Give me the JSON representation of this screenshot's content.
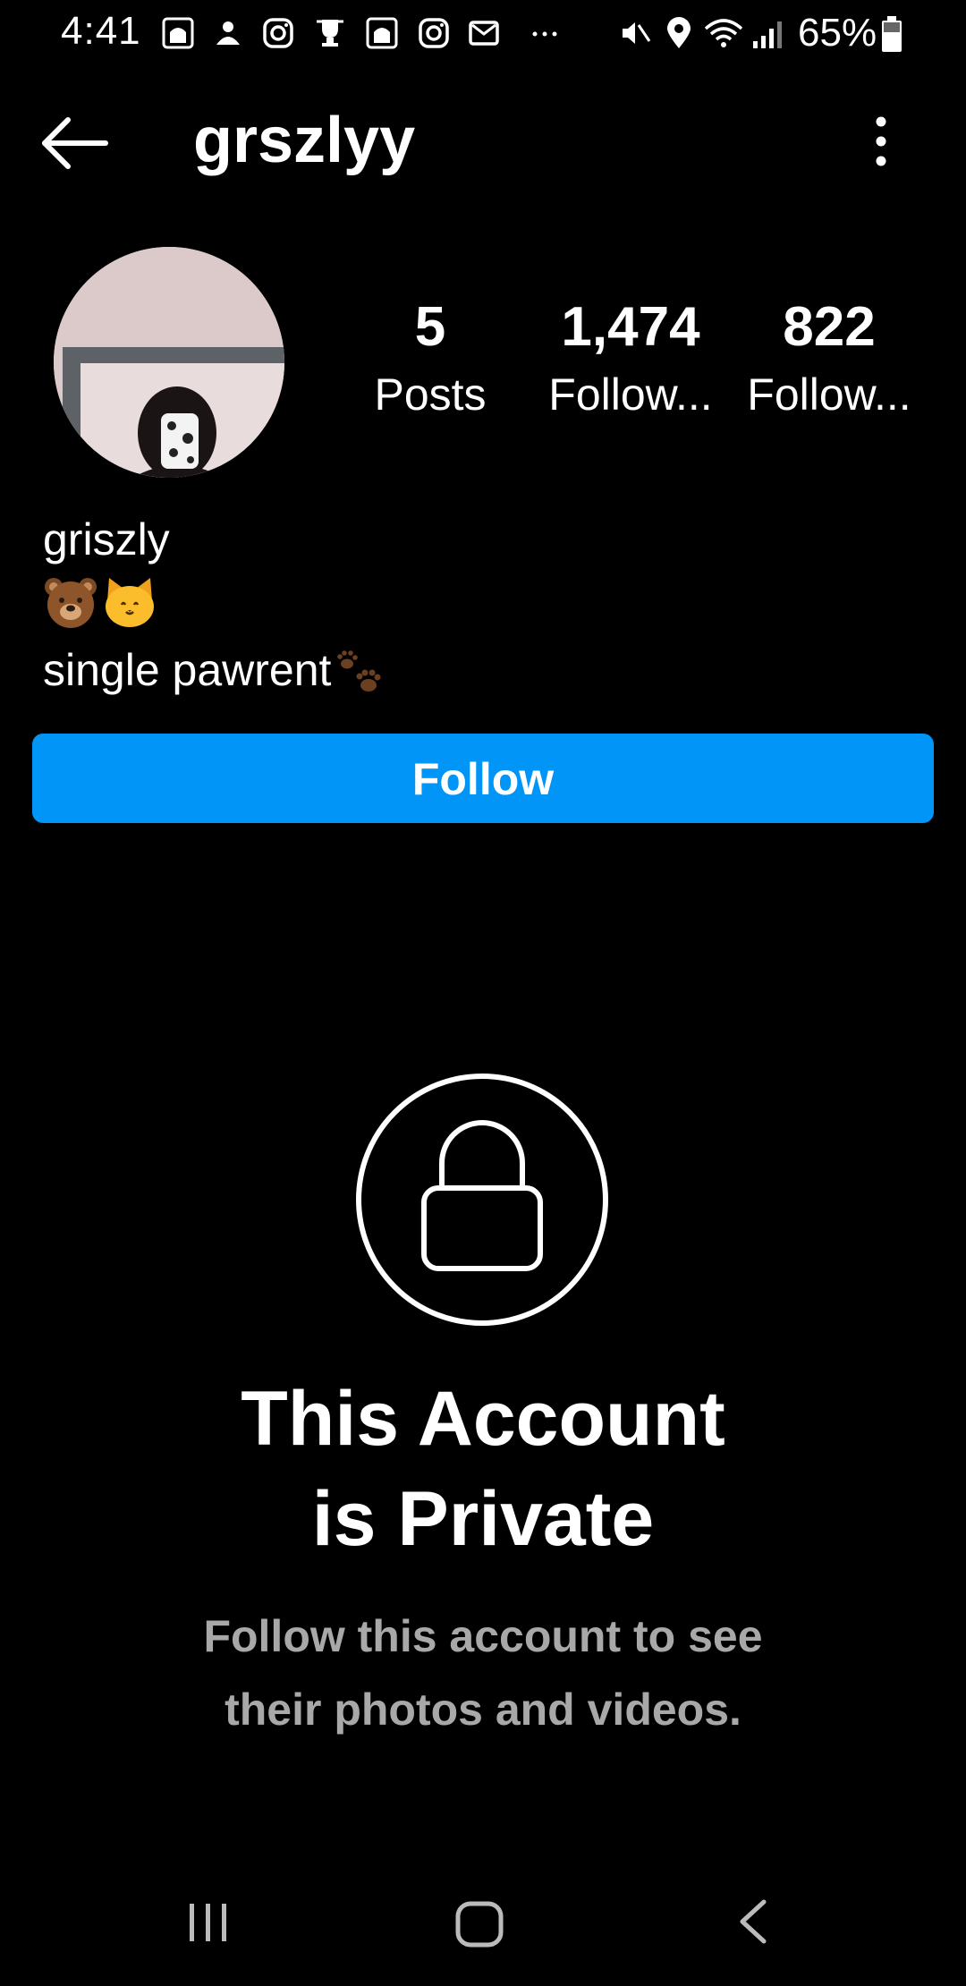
{
  "status_bar": {
    "time": "4:41",
    "battery": "65%"
  },
  "header": {
    "username": "grszlyy"
  },
  "stats": [
    {
      "value": "5",
      "label": "Posts"
    },
    {
      "value": "1,474",
      "label": "Follow..."
    },
    {
      "value": "822",
      "label": "Follow..."
    }
  ],
  "bio": {
    "display_name": "griszly",
    "emoji_line": "🐻🐱",
    "text": "single pawrent",
    "text_emoji": "🐾"
  },
  "follow_button": {
    "label": "Follow"
  },
  "private": {
    "title_line1": "This Account",
    "title_line2": "is Private",
    "subtitle_line1": "Follow this account to see",
    "subtitle_line2": "their photos and videos."
  },
  "colors": {
    "accent": "#0095f6",
    "background": "#000000",
    "secondary_text": "#a8a8a8"
  }
}
